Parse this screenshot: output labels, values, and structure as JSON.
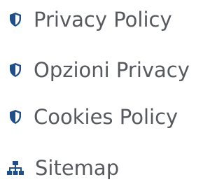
{
  "links": [
    {
      "label": "Privacy Policy",
      "icon": "shield-icon"
    },
    {
      "label": "Opzioni Privacy",
      "icon": "shield-icon"
    },
    {
      "label": "Cookies Policy",
      "icon": "shield-icon"
    },
    {
      "label": "Sitemap",
      "icon": "sitemap-icon"
    }
  ],
  "colors": {
    "icon": "#1f4f8a",
    "text": "#56595e"
  }
}
